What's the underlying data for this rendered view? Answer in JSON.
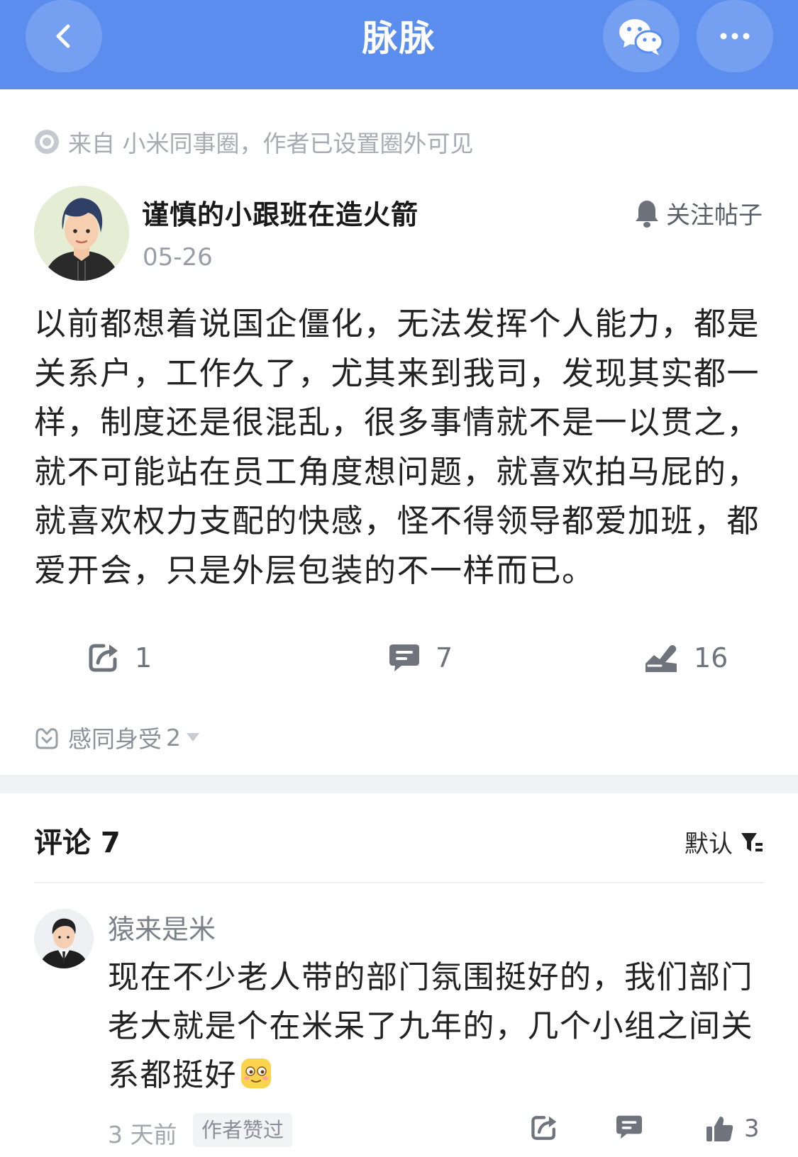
{
  "header": {
    "title": "脉脉",
    "back_icon": "chevron-left-icon",
    "wechat_icon": "wechat-icon",
    "more_icon": "more-dots-icon",
    "bg_color": "#5b8def"
  },
  "source": {
    "text": "来自 小米同事圈，作者已设置圈外可见"
  },
  "post": {
    "author": "谨慎的小跟班在造火箭",
    "date": "05-26",
    "follow_label": "关注帖子",
    "body": "以前都想着说国企僵化，无法发挥个人能力，都是关系户，工作久了，尤其来到我司，发现其实都一样，制度还是很混乱，很多事情就不是一以贯之，就不可能站在员工角度想问题，就喜欢拍马屁的，就喜欢权力支配的快感，怪不得领导都爱加班，都爱开会，只是外层包装的不一样而已。",
    "share_count": "1",
    "comment_count": "7",
    "like_count": "16",
    "reaction_label": "感同身受",
    "reaction_count": "2"
  },
  "comments": {
    "title": "评论 7",
    "sort_label": "默认",
    "items": [
      {
        "name": "猿来是米",
        "text": "现在不少老人带的部门氛围挺好的，我们部门老大就是个在米呆了九年的，几个小组之间关系都挺好",
        "time": "3 天前",
        "badge": "作者赞过",
        "like_count": "3"
      }
    ]
  }
}
